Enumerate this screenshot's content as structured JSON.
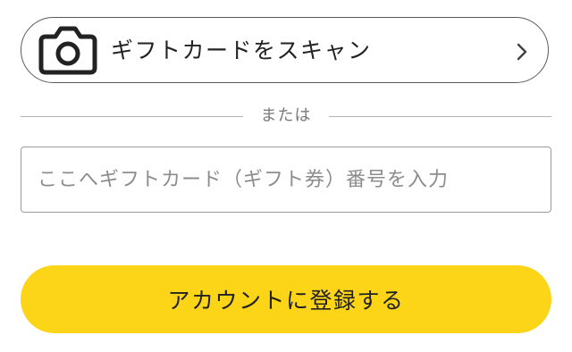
{
  "scan": {
    "label": "ギフトカードをスキャン",
    "icon": "camera-icon",
    "chevron": "chevron-right-icon"
  },
  "divider": {
    "text": "または"
  },
  "gift_code": {
    "value": "",
    "placeholder": "ここへギフトカード（ギフト券）番号を入力"
  },
  "register": {
    "label": "アカウントに登録する",
    "color": "#fcd418"
  }
}
